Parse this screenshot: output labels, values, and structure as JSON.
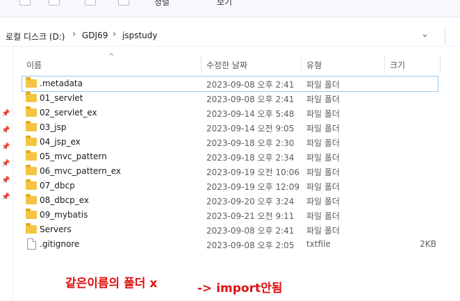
{
  "toolbar": {
    "items": [
      "정렬",
      "보기"
    ]
  },
  "address": {
    "crumbs": [
      "로컬 디스크 (D:)",
      "GDJ69",
      "jspstudy"
    ],
    "separator": "›",
    "dropdown": "⌄"
  },
  "columns": {
    "name": "이름",
    "date": "수정한 날짜",
    "type": "유형",
    "size": "크기",
    "sort_indicator": "^"
  },
  "rows": [
    {
      "name": ".metadata",
      "date": "2023-09-08 오후 2:41",
      "type": "파일 폴더",
      "size": "",
      "icon": "folder-icon",
      "selected": true
    },
    {
      "name": "01_servlet",
      "date": "2023-09-08 오후 2:41",
      "type": "파일 폴더",
      "size": "",
      "icon": "folder-icon"
    },
    {
      "name": "02_servlet_ex",
      "date": "2023-09-14 오후 5:48",
      "type": "파일 폴더",
      "size": "",
      "icon": "folder-icon"
    },
    {
      "name": "03_jsp",
      "date": "2023-09-14 오전 9:05",
      "type": "파일 폴더",
      "size": "",
      "icon": "folder-icon"
    },
    {
      "name": "04_jsp_ex",
      "date": "2023-09-18 오후 2:30",
      "type": "파일 폴더",
      "size": "",
      "icon": "folder-icon"
    },
    {
      "name": "05_mvc_pattern",
      "date": "2023-09-18 오후 2:34",
      "type": "파일 폴더",
      "size": "",
      "icon": "folder-icon"
    },
    {
      "name": "06_mvc_pattern_ex",
      "date": "2023-09-19 오전 10:06",
      "type": "파일 폴더",
      "size": "",
      "icon": "folder-icon"
    },
    {
      "name": "07_dbcp",
      "date": "2023-09-19 오후 12:09",
      "type": "파일 폴더",
      "size": "",
      "icon": "folder-icon"
    },
    {
      "name": "08_dbcp_ex",
      "date": "2023-09-20 오후 3:24",
      "type": "파일 폴더",
      "size": "",
      "icon": "folder-icon"
    },
    {
      "name": "09_mybatis",
      "date": "2023-09-21 오전 9:11",
      "type": "파일 폴더",
      "size": "",
      "icon": "folder-icon"
    },
    {
      "name": "Servers",
      "date": "2023-09-08 오후 2:41",
      "type": "파일 폴더",
      "size": "",
      "icon": "folder-icon"
    },
    {
      "name": ".gitignore",
      "date": "2023-09-08 오후 2:05",
      "type": "txtfile",
      "size": "2KB",
      "icon": "file-icon"
    }
  ],
  "annotations": {
    "note1": "같은이름의 폴더 x",
    "note2": "-> import안됨"
  },
  "colors": {
    "accent": "#e01010",
    "folder": "#f4c542",
    "selection": "#99c9ef"
  }
}
